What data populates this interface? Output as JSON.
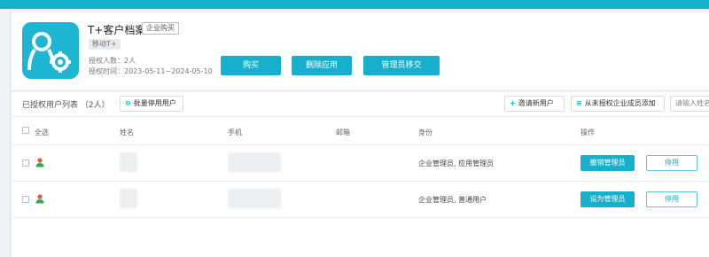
{
  "app": {
    "name": "T+客户档案",
    "purchase_badge": "企业购买",
    "platform_chip": "移动T+",
    "licensed_users": "授权人数：2人",
    "license_period": "授权时间：2023-05-11~2024-05-10"
  },
  "actions": {
    "buy": "购买",
    "delete": "删除应用",
    "transfer_admin": "管理员移交"
  },
  "toolbar": {
    "list_title": "已授权用户列表 （2人）",
    "batch_disable": "批量停用用户",
    "invite_new": "邀请新用户",
    "add_from_unlicensed": "从未授权企业成员添加",
    "search_placeholder": "请输入姓名"
  },
  "table": {
    "columns": [
      "全选",
      "姓名",
      "手机",
      "邮箱",
      "身份",
      "操作"
    ],
    "rows": [
      {
        "role": "企业管理员, 应用管理员",
        "primary_action": "撤销管理员",
        "secondary_action": "停用"
      },
      {
        "role": "企业管理员, 普通用户",
        "primary_action": "设为管理员",
        "secondary_action": "停用"
      }
    ]
  },
  "colors": {
    "accent": "#16b0cc",
    "user_icon_green": "#3aa845",
    "user_icon_red": "#e2574c"
  }
}
